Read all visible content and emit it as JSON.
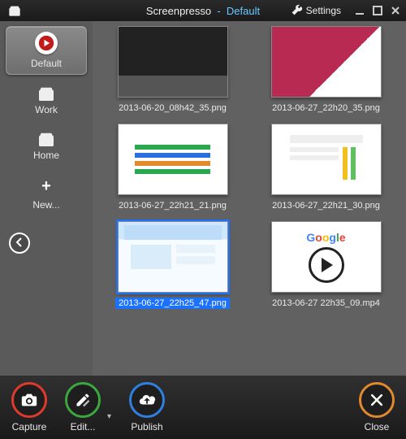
{
  "titlebar": {
    "app_name": "Screenpresso",
    "separator": "-",
    "workspace": "Default",
    "settings_label": "Settings"
  },
  "sidebar": {
    "items": [
      {
        "label": "Default"
      },
      {
        "label": "Work"
      },
      {
        "label": "Home"
      },
      {
        "label": "New..."
      }
    ]
  },
  "files": [
    {
      "name": "2013-06-20_08h42_35.png",
      "selected": false,
      "kind": "image"
    },
    {
      "name": "2013-06-27_22h20_35.png",
      "selected": false,
      "kind": "image"
    },
    {
      "name": "2013-06-27_22h21_21.png",
      "selected": false,
      "kind": "image"
    },
    {
      "name": "2013-06-27_22h21_30.png",
      "selected": false,
      "kind": "image"
    },
    {
      "name": "2013-06-27_22h25_47.png",
      "selected": true,
      "kind": "image"
    },
    {
      "name": "2013-06-27 22h35_09.mp4",
      "selected": false,
      "kind": "video"
    }
  ],
  "bottombar": {
    "capture_label": "Capture",
    "edit_label": "Edit...",
    "publish_label": "Publish",
    "close_label": "Close"
  },
  "colors": {
    "red": "#e03a2f",
    "green": "#3aa83f",
    "blue": "#2f7fe0",
    "orange": "#e08a2f",
    "selection": "#1a72ff"
  }
}
